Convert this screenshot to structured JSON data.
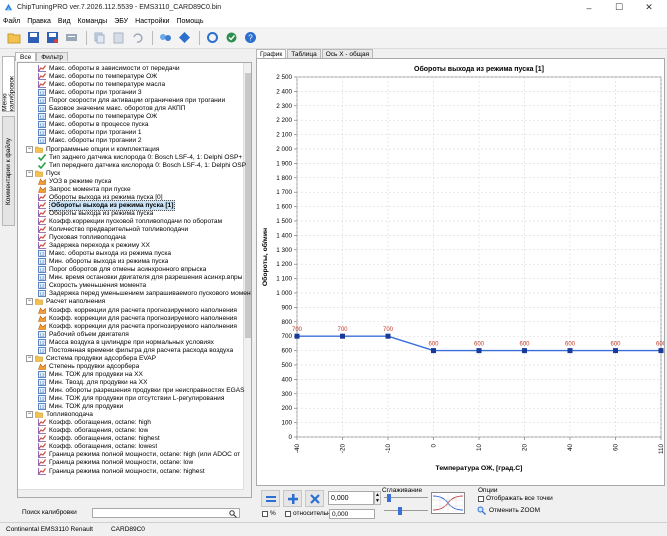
{
  "window": {
    "title": "ChipTuningPRO ver.7.2026.112.5539 - EMS3110_CARD89C0.bin",
    "controls": [
      "–",
      "☐",
      "✕"
    ]
  },
  "menu": [
    "Файл",
    "Правка",
    "Вид",
    "Команды",
    "ЭБУ",
    "Настройки",
    "Помощь"
  ],
  "toolbar_icons": [
    "open-folder-icon",
    "save-icon",
    "save-as-icon",
    "edit-icon",
    "copy-icon",
    "paste-icon",
    "undo-icon",
    "connect-icon",
    "diamond-icon",
    "refresh-icon",
    "checksum-icon",
    "help-icon"
  ],
  "side_tabs": [
    "Меню калибровок",
    "Комментарии к файлу"
  ],
  "left_tabs": [
    "Все",
    "Фильтр"
  ],
  "tree": [
    {
      "level": 2,
      "icon": "curve",
      "label": "Макс. обороты  в зависимости от передачи"
    },
    {
      "level": 2,
      "icon": "curve",
      "label": "Макс. обороты по температуре ОЖ"
    },
    {
      "level": 2,
      "icon": "curve",
      "label": "Макс. обороты по температуре масла"
    },
    {
      "level": 2,
      "icon": "value",
      "label": "Макс. обороты при трогании 3"
    },
    {
      "level": 2,
      "icon": "value",
      "label": "Порог скорости для активации ограничения при трогании"
    },
    {
      "level": 2,
      "icon": "value",
      "label": "Базовое значение макс. оборотов для АКПП"
    },
    {
      "level": 2,
      "icon": "value",
      "label": "Макс. обороты по температуре ОЖ"
    },
    {
      "level": 2,
      "icon": "value",
      "label": "Макс. обороты в процессе пуска"
    },
    {
      "level": 2,
      "icon": "value",
      "label": "Макс. обороты при трогании 1"
    },
    {
      "level": 2,
      "icon": "value",
      "label": "Макс. обороты при трогании 2"
    },
    {
      "level": 1,
      "icon": "folder",
      "label": "Программные опции и комплектация",
      "expanded": true
    },
    {
      "level": 2,
      "icon": "check",
      "label": "Тип заднего датчика кислорода 0: Bosch LSF-4, 1: Delphi OSP+"
    },
    {
      "level": 2,
      "icon": "check",
      "label": "Тип переднего датчика кислорода 0: Bosch LSF-4, 1: Delphi OSP"
    },
    {
      "level": 1,
      "icon": "folder",
      "label": "Пуск",
      "expanded": true
    },
    {
      "level": 2,
      "icon": "map",
      "label": "УОЗ в режиме пуска"
    },
    {
      "level": 2,
      "icon": "map",
      "label": "Запрос момента при пуске"
    },
    {
      "level": 2,
      "icon": "curve",
      "label": "Обороты выхода из режима пуска [0]"
    },
    {
      "level": 2,
      "icon": "curve",
      "label": "Обороты выхода из режима пуска [1]",
      "selected": true
    },
    {
      "level": 2,
      "icon": "curve",
      "label": "Обороты выхода из режима пуска"
    },
    {
      "level": 2,
      "icon": "curve",
      "label": "Коэфф.коррекции пусковой топливоподачи по оборотам"
    },
    {
      "level": 2,
      "icon": "curve",
      "label": "Количество предварительной топливоподачи"
    },
    {
      "level": 2,
      "icon": "curve",
      "label": "Пусковая топливоподача"
    },
    {
      "level": 2,
      "icon": "curve",
      "label": "Задержка перехода к режиму ХХ"
    },
    {
      "level": 2,
      "icon": "value",
      "label": "Макс. обороты выхода из режима пуска"
    },
    {
      "level": 2,
      "icon": "value",
      "label": "Мин. обороты выхода из режима пуска"
    },
    {
      "level": 2,
      "icon": "value",
      "label": "Порог оборотов для отмены асинхронного впрыска"
    },
    {
      "level": 2,
      "icon": "value",
      "label": "Мин. время остановки двигателя для разрешения асинхр.впры"
    },
    {
      "level": 2,
      "icon": "value",
      "label": "Скорость уменьшения момента"
    },
    {
      "level": 2,
      "icon": "value",
      "label": "Задержка перед уменьшением запрашиваемого пускового момента"
    },
    {
      "level": 1,
      "icon": "folder",
      "label": "Расчет наполнения",
      "expanded": true
    },
    {
      "level": 2,
      "icon": "map",
      "label": "Коэфф. коррекции для расчета прогнозируемого наполнения"
    },
    {
      "level": 2,
      "icon": "map",
      "label": "Коэфф. коррекции для расчета прогнозируемого наполнения"
    },
    {
      "level": 2,
      "icon": "map",
      "label": "Коэфф. коррекции для расчета прогнозируемого наполнения"
    },
    {
      "level": 2,
      "icon": "value",
      "label": "Рабочий объем двигателя"
    },
    {
      "level": 2,
      "icon": "value",
      "label": "Масса воздуха в цилиндре при нормальных условиях"
    },
    {
      "level": 2,
      "icon": "value",
      "label": "Постоянная времени фильтра для расчета расхода воздуха"
    },
    {
      "level": 1,
      "icon": "folder",
      "label": "Система продувки адсорбера EVAP",
      "expanded": true
    },
    {
      "level": 2,
      "icon": "map",
      "label": "Степень продувки адсорбера"
    },
    {
      "level": 2,
      "icon": "value",
      "label": "Мин. ТОЖ для продувки на ХХ"
    },
    {
      "level": 2,
      "icon": "value",
      "label": "Мин. Твозд. для продувки на ХХ"
    },
    {
      "level": 2,
      "icon": "value",
      "label": "Мин. обороты разрешения продувки при неисправностях EGAS"
    },
    {
      "level": 2,
      "icon": "value",
      "label": "Мин. ТОЖ для продувки при отсутствии L-регулирования"
    },
    {
      "level": 2,
      "icon": "value",
      "label": "Мин. ТОЖ для продувки"
    },
    {
      "level": 1,
      "icon": "folder",
      "label": "Топливоподача",
      "expanded": true
    },
    {
      "level": 2,
      "icon": "curve",
      "label": "Коэфф. обогащения, octane: high"
    },
    {
      "level": 2,
      "icon": "curve",
      "label": "Коэфф. обогащения, octane: low"
    },
    {
      "level": 2,
      "icon": "curve",
      "label": "Коэфф. обогащения, octane: highest"
    },
    {
      "level": 2,
      "icon": "curve",
      "label": "Коэфф. обогащения, octane: lowest"
    },
    {
      "level": 2,
      "icon": "curve",
      "label": "Граница режима полной мощности, octane: high (или ADOC от"
    },
    {
      "level": 2,
      "icon": "curve",
      "label": "Граница режима полной мощности, octane: low"
    },
    {
      "level": 2,
      "icon": "curve",
      "label": "Граница режима полной мощности, octane: highest"
    }
  ],
  "search": {
    "label": "Поиск калибровки",
    "value": ""
  },
  "right_tabs": [
    "График",
    "Таблица",
    "Ось X - общая"
  ],
  "chart_data": {
    "type": "line",
    "title": "Обороты выхода из режима пуска [1]",
    "xlabel": "Температура ОЖ, [град.С]",
    "ylabel": "Обороты, об/мин",
    "x": [
      -40,
      -20,
      -10,
      0,
      10,
      20,
      40,
      60,
      110
    ],
    "x_tick_labels": [
      "-40",
      "-20",
      "-10",
      "0",
      "10",
      "20",
      "40",
      "60",
      "110"
    ],
    "values": [
      700,
      700,
      700,
      600,
      600,
      600,
      600,
      600,
      600
    ],
    "data_labels": [
      "700",
      "700",
      "700",
      "600",
      "600",
      "600",
      "600",
      "600",
      "600"
    ],
    "ylim": [
      0,
      2500
    ],
    "y_ticks": [
      0,
      100,
      200,
      300,
      400,
      500,
      600,
      700,
      800,
      900,
      1000,
      1100,
      1200,
      1300,
      1400,
      1500,
      1600,
      1700,
      1800,
      1900,
      2000,
      2100,
      2200,
      2300,
      2400,
      2500
    ],
    "y_tick_labels": [
      "0",
      "100",
      "200",
      "300",
      "400",
      "500",
      "600",
      "700",
      "800",
      "900",
      "1 000",
      "1 100",
      "1 200",
      "1 300",
      "1 400",
      "1 500",
      "1 600",
      "1 700",
      "1 800",
      "1 900",
      "2 000",
      "2 100",
      "2 200",
      "2 300",
      "2 400",
      "2 500"
    ],
    "grid": true,
    "line_color": "#3a6fd8",
    "point_color": "#1a3a9a",
    "label_color": "#c0392b"
  },
  "bottom": {
    "value1": "0,000",
    "percent_label": "%",
    "relative_label": "относительно",
    "value2": "0,000",
    "smoothing_label": "Сглаживание",
    "options_label": "Опции",
    "show_all_points": "Отображать все точки",
    "cancel_zoom": "Отменить ZOOM"
  },
  "status": {
    "ecu": "Continental EMS3110 Renault",
    "card": "CARD89C0"
  }
}
